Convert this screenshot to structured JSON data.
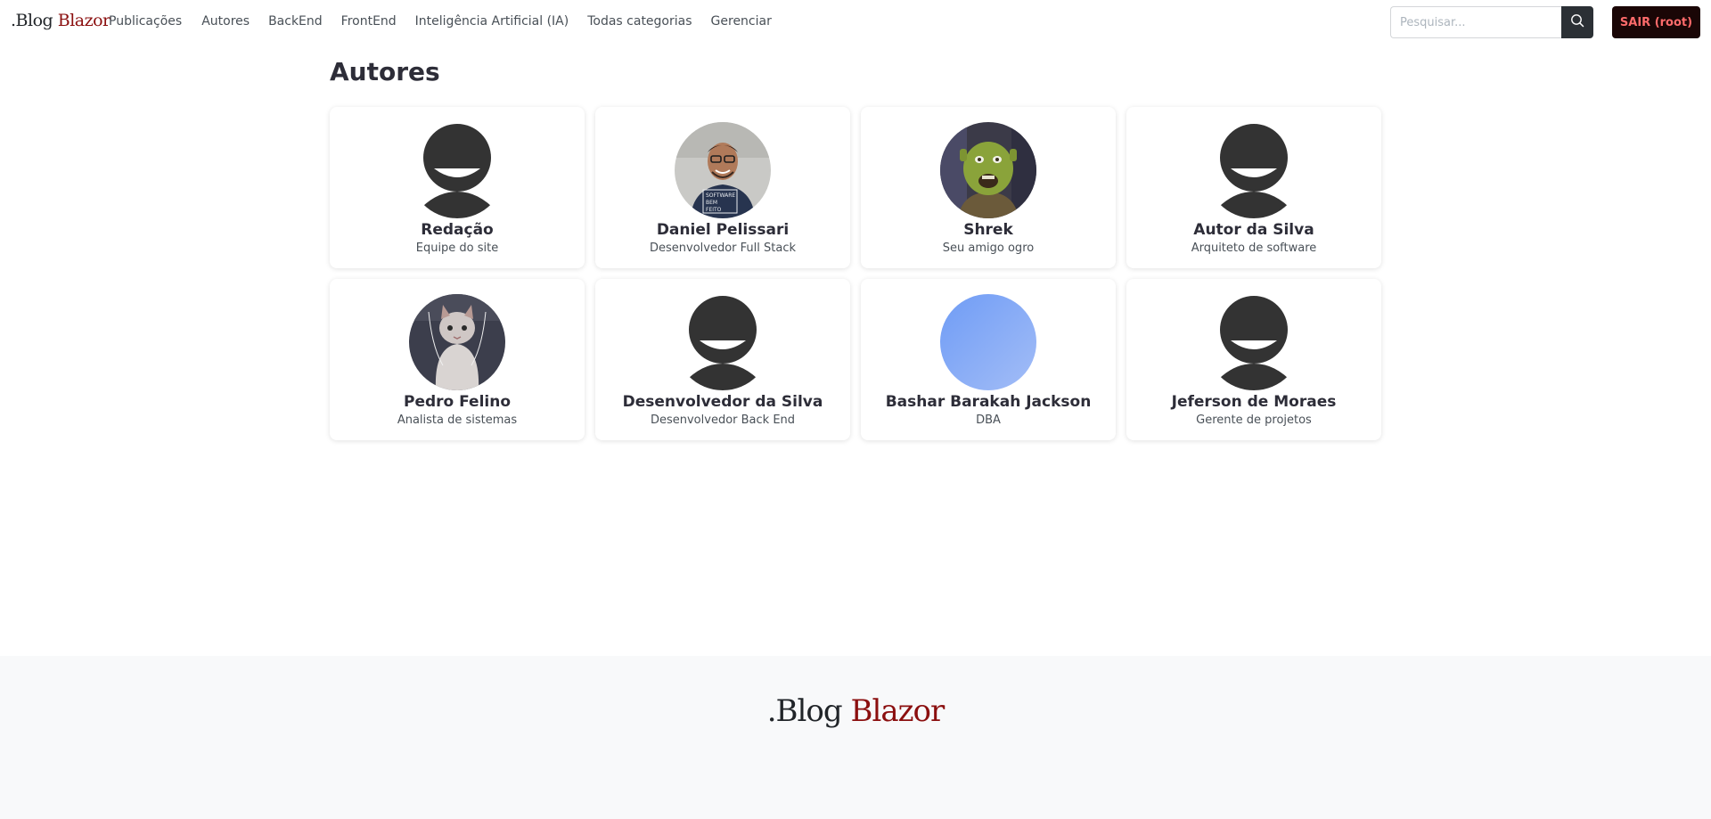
{
  "brand": {
    "prefix": ".Blog",
    "accent": "Blazor",
    "accent_color": "#8b0f0f"
  },
  "nav": {
    "links": [
      "Publicações",
      "Autores",
      "BackEnd",
      "FrontEnd",
      "Inteligência Artificial (IA)",
      "Todas categorias",
      "Gerenciar"
    ]
  },
  "search": {
    "placeholder": "Pesquisar...",
    "icon": "search-icon"
  },
  "logout": {
    "label": "SAIR (root)"
  },
  "main": {
    "title": "Autores",
    "authors": [
      {
        "name": "Redação",
        "role": "Equipe do site",
        "avatar": "default-user-icon"
      },
      {
        "name": "Daniel Pelissari",
        "role": "Desenvolvedor Full Stack",
        "avatar": "photo-man-glasses"
      },
      {
        "name": "Shrek",
        "role": "Seu amigo ogro",
        "avatar": "photo-ogre"
      },
      {
        "name": "Autor da Silva",
        "role": "Arquiteto de software",
        "avatar": "default-user-icon"
      },
      {
        "name": "Pedro Felino",
        "role": "Analista de sistemas",
        "avatar": "photo-cat"
      },
      {
        "name": "Desenvolvedor da Silva",
        "role": "Desenvolvedor Back End",
        "avatar": "default-user-icon"
      },
      {
        "name": "Bashar Barakah Jackson",
        "role": "DBA",
        "avatar": "gradient-blue"
      },
      {
        "name": "Jeferson de Moraes",
        "role": "Gerente de projetos",
        "avatar": "default-user-icon"
      }
    ]
  },
  "footer": {
    "prefix": ".Blog",
    "accent": "Blazor"
  }
}
